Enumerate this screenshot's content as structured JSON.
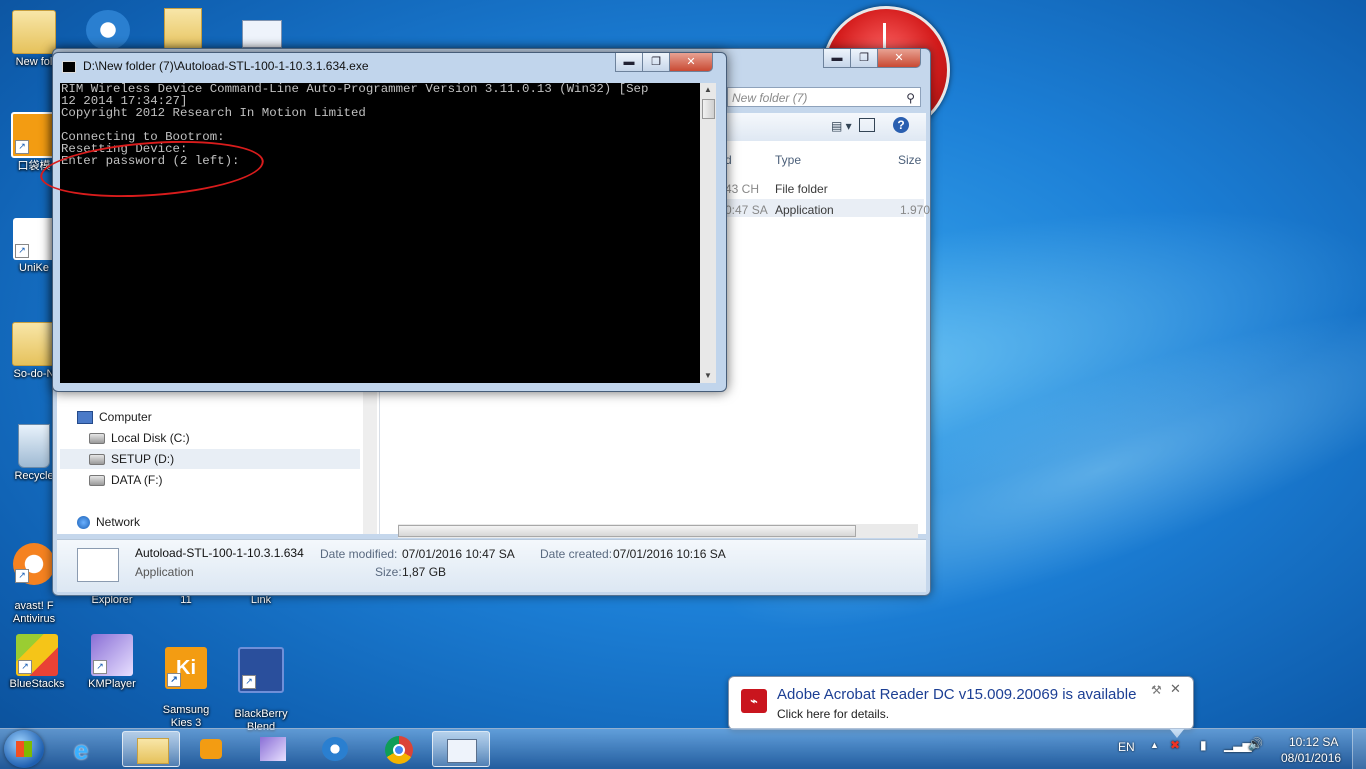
{
  "desktop": {
    "icons": [
      {
        "label": "New fol"
      },
      {
        "label": "口袋模"
      },
      {
        "label": "UniKe"
      },
      {
        "label": "So-do-N"
      },
      {
        "label": "Recycle"
      },
      {
        "label": "avast! F\nAntivirus"
      },
      {
        "label": "Explorer"
      },
      {
        "label": "11"
      },
      {
        "label": "Link"
      },
      {
        "label": "BlueStacks"
      },
      {
        "label": "KMPlayer"
      },
      {
        "label": "Samsung\nKies 3"
      },
      {
        "label": "BlackBerry\nBlend"
      }
    ]
  },
  "cmd_window": {
    "title": "D:\\New folder (7)\\Autoload-STL-100-1-10.3.1.634.exe",
    "lines": [
      "RIM Wireless Device Command-Line Auto-Programmer Version 3.11.0.13 (Win32) [Sep",
      "12 2014 17:34:27]",
      "Copyright 2012 Research In Motion Limited",
      "",
      "Connecting to Bootrom:",
      "Resetting Device:",
      "Enter password (2 left):"
    ]
  },
  "explorer": {
    "search_placeholder": "Search New folder (7)",
    "search_visible": "New folder (7)",
    "columns": {
      "date": "d",
      "type": "Type",
      "size": "Size"
    },
    "rows": [
      {
        "date": "43 CH",
        "type": "File folder",
        "size": ""
      },
      {
        "date": "0:47 SA",
        "type": "Application",
        "size": "1.970"
      }
    ],
    "nav": {
      "computer": "Computer",
      "drives": [
        "Local Disk (C:)",
        "SETUP (D:)",
        "DATA (F:)"
      ],
      "network": "Network"
    },
    "details": {
      "filename": "Autoload-STL-100-1-10.3.1.634",
      "kind": "Application",
      "date_modified_label": "Date modified:",
      "date_modified": "07/01/2016 10:47 SA",
      "date_created_label": "Date created:",
      "date_created": "07/01/2016 10:16 SA",
      "size_label": "Size:",
      "size": "1,87 GB"
    }
  },
  "notification": {
    "title": "Adobe Acrobat Reader DC v15.009.20069 is available",
    "body": "Click here for details."
  },
  "taskbar": {
    "language": "EN",
    "time": "10:12 SA",
    "date": "08/01/2016"
  },
  "colors": {
    "accent": "#1c7fd6",
    "red_mark": "#d91c1c"
  }
}
